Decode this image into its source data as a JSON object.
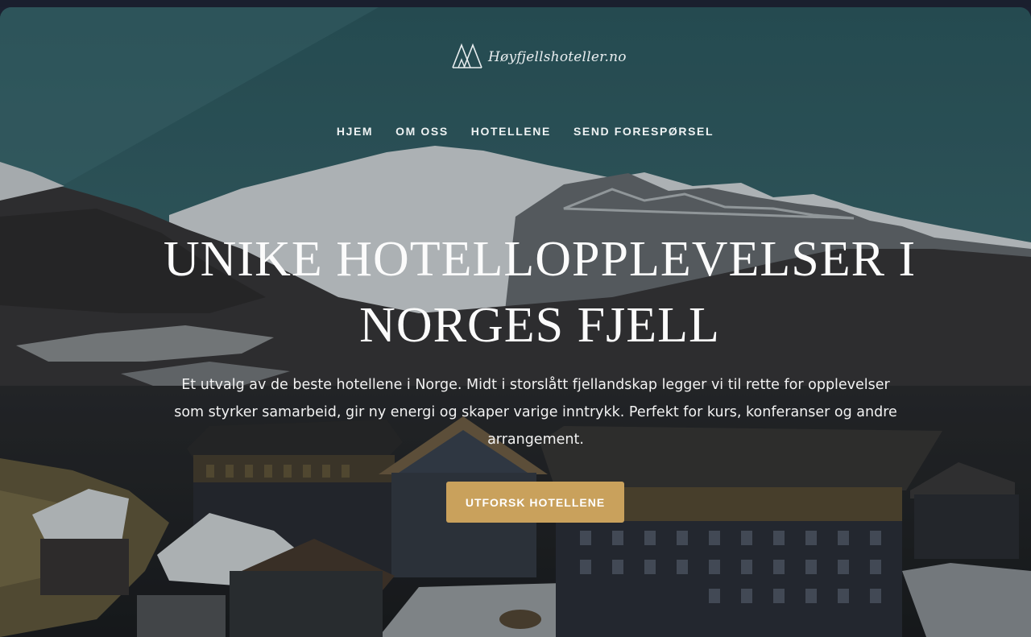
{
  "brand": {
    "logo_text": "Høyfjellshoteller.no",
    "logo_icon": "mountain-tents-icon"
  },
  "nav": {
    "items": [
      {
        "label": "HJEM"
      },
      {
        "label": "OM OSS"
      },
      {
        "label": "HOTELLENE"
      },
      {
        "label": "SEND FORESPØRSEL"
      }
    ]
  },
  "hero": {
    "headline_line1": "UNIKE HOTELLOPPLEVELSER I",
    "headline_line2": "NORGES FJELL",
    "description": "Et utvalg av de beste hotellene i Norge. Midt i storslått fjellandskap legger vi til rette for opplevelser som styrker samarbeid, gir ny energi og skaper varige inntrykk. Perfekt for kurs, konferanser og andre arrangement.",
    "cta_label": "UTFORSK HOTELLENE"
  },
  "colors": {
    "accent": "#c9a15c",
    "sky": "#3e6f74",
    "text": "#ffffff"
  }
}
